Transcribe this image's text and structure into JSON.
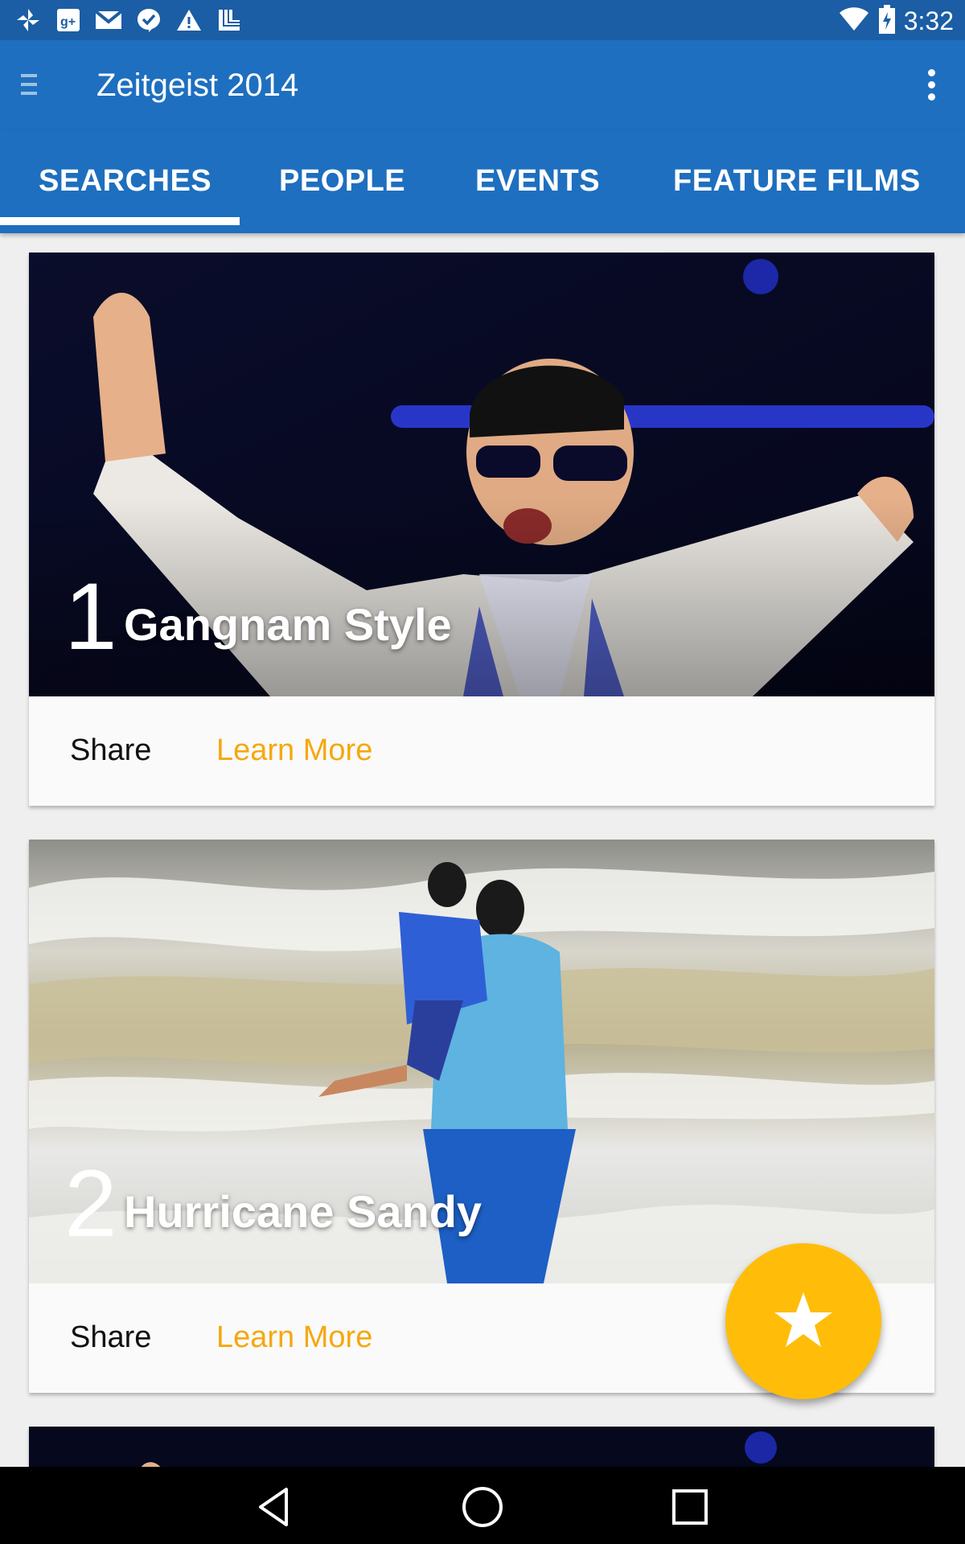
{
  "status_bar": {
    "time": "3:32",
    "left_icons": [
      "pinwheel-icon",
      "google-plus-icon",
      "gmail-icon",
      "check-bubble-icon",
      "warning-icon",
      "stack-icon"
    ],
    "right_icons": [
      "wifi-icon",
      "battery-charging-icon"
    ]
  },
  "app_bar": {
    "title": "Zeitgeist 2014"
  },
  "tabs": [
    {
      "label": "SEARCHES",
      "selected": true
    },
    {
      "label": "PEOPLE",
      "selected": false
    },
    {
      "label": "EVENTS",
      "selected": false
    },
    {
      "label": "FEATURE FILMS",
      "selected": false
    }
  ],
  "cards": [
    {
      "rank": "1",
      "title": "Gangnam Style",
      "share_label": "Share",
      "learn_label": "Learn More"
    },
    {
      "rank": "2",
      "title": "Hurricane Sandy",
      "share_label": "Share",
      "learn_label": "Learn More"
    }
  ],
  "colors": {
    "primary": "#1e6fbf",
    "status_bar": "#1b5ea5",
    "accent": "#ffbd0a",
    "learn_more": "#f5a80f"
  },
  "fab": {
    "icon": "star-icon"
  },
  "nav_bar": {
    "icons": [
      "back-icon",
      "home-icon",
      "recents-icon"
    ]
  }
}
